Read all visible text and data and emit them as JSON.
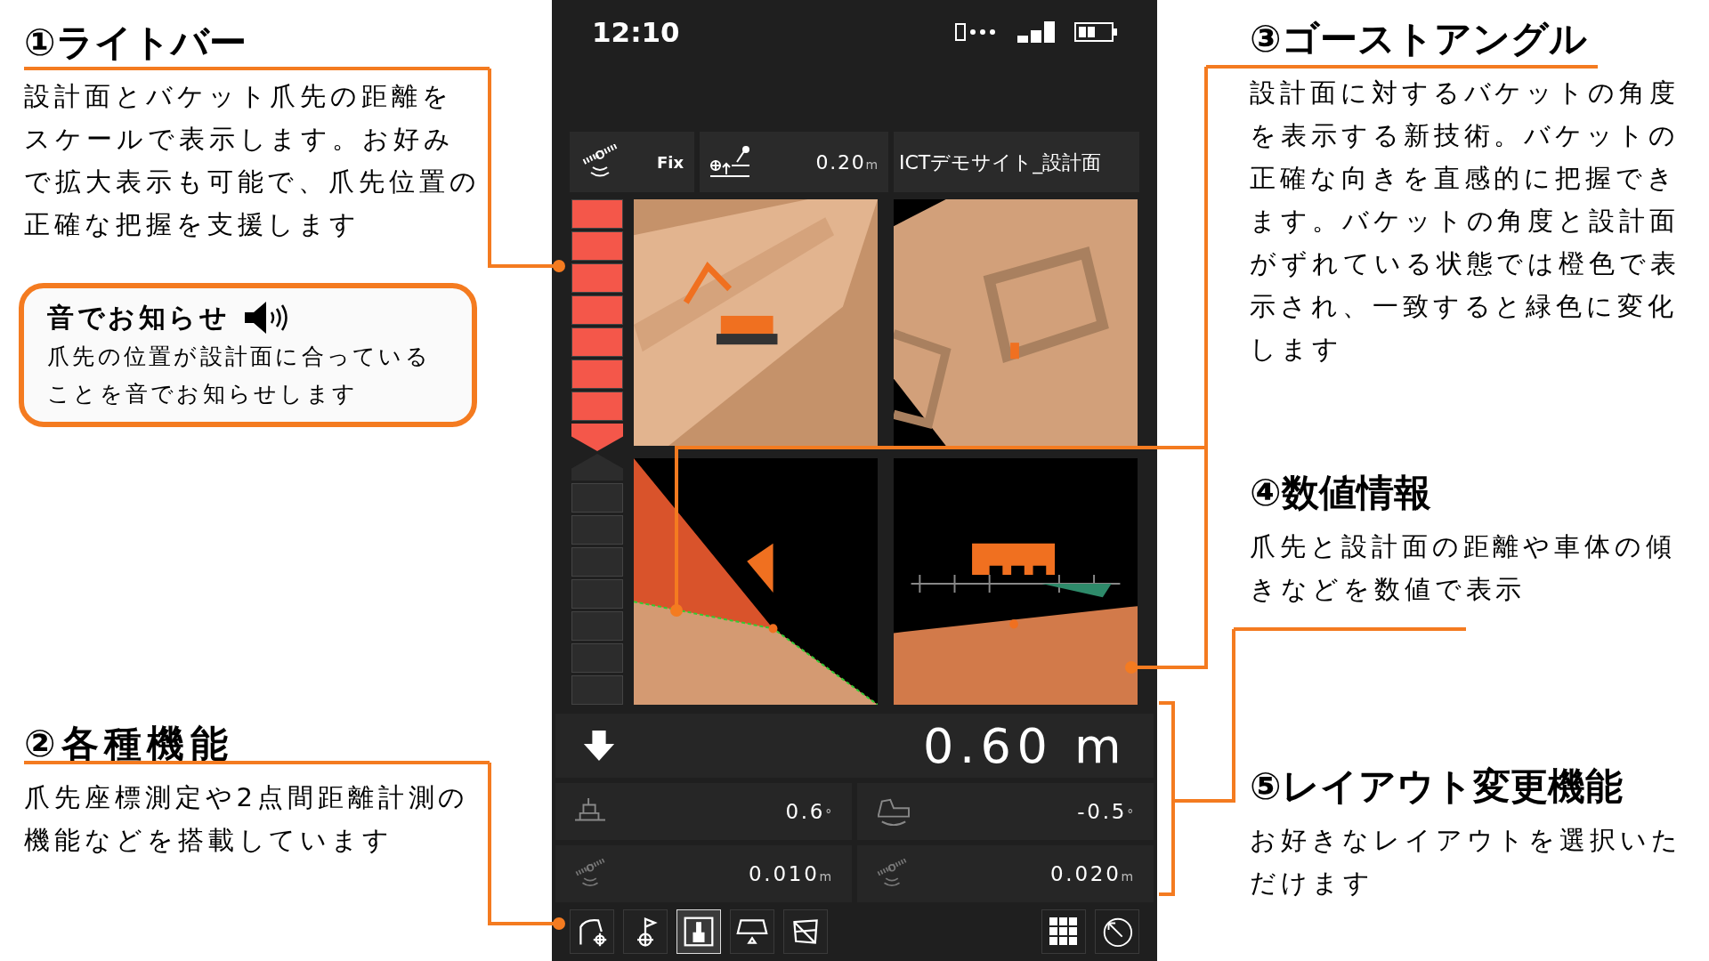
{
  "annotations": [
    {
      "title": "①ライトバー",
      "text": "設計面とバケット爪先の距離をスケールで表示します。お好みで拡大表示も可能で、爪先位置の正確な把握を支援します"
    },
    {
      "title": "②各種機能",
      "text": "爪先座標測定や2点間距離計測の機能などを搭載しています"
    },
    {
      "title": "③ゴーストアングル",
      "text": "設計面に対するバケットの角度を表示する新技術。バケットの正確な向きを直感的に把握できます。バケットの角度と設計面がずれている状態では橙色で表示され、一致すると緑色に変化します"
    },
    {
      "title": "④数値情報",
      "text": "爪先と設計面の距離や車体の傾きなどを数値で表示"
    },
    {
      "title": "⑤レイアウト変更機能",
      "text": "お好きなレイアウトを選択いただけます"
    }
  ],
  "sound_notice": {
    "title": "音でお知らせ",
    "text": "爪先の位置が設計面に合っていることを音でお知らせします"
  },
  "phone": {
    "status_bar": {
      "time": "12:10"
    },
    "info_bar": {
      "gnss_status": "Fix",
      "height_offset": {
        "value": "0.20",
        "unit": "m"
      },
      "design_surface": "ICTデモサイト_設計面"
    },
    "light_bar": {
      "segments": [
        {
          "kind": "bar",
          "lit": true
        },
        {
          "kind": "bar",
          "lit": true
        },
        {
          "kind": "bar",
          "lit": true
        },
        {
          "kind": "bar",
          "lit": true
        },
        {
          "kind": "bar",
          "lit": true
        },
        {
          "kind": "bar",
          "lit": true
        },
        {
          "kind": "bar",
          "lit": true
        },
        {
          "kind": "arrow_down",
          "lit": true
        },
        {
          "kind": "arrow_up",
          "lit": false
        },
        {
          "kind": "bar",
          "lit": false
        },
        {
          "kind": "bar",
          "lit": false
        },
        {
          "kind": "bar",
          "lit": false
        },
        {
          "kind": "bar",
          "lit": false
        },
        {
          "kind": "bar",
          "lit": false
        },
        {
          "kind": "bar",
          "lit": false
        },
        {
          "kind": "bar",
          "lit": false
        }
      ]
    },
    "distance": {
      "value": "0.60",
      "unit": "m"
    },
    "readings": [
      {
        "value": "0.6",
        "unit": "°"
      },
      {
        "value": "-0.5",
        "unit": "°"
      },
      {
        "value": "0.010",
        "unit": "m"
      },
      {
        "value": "0.020",
        "unit": "m"
      }
    ],
    "tools": [
      {
        "selected": false
      },
      {
        "selected": false
      },
      {
        "selected": true
      },
      {
        "selected": false
      },
      {
        "selected": false
      }
    ]
  }
}
